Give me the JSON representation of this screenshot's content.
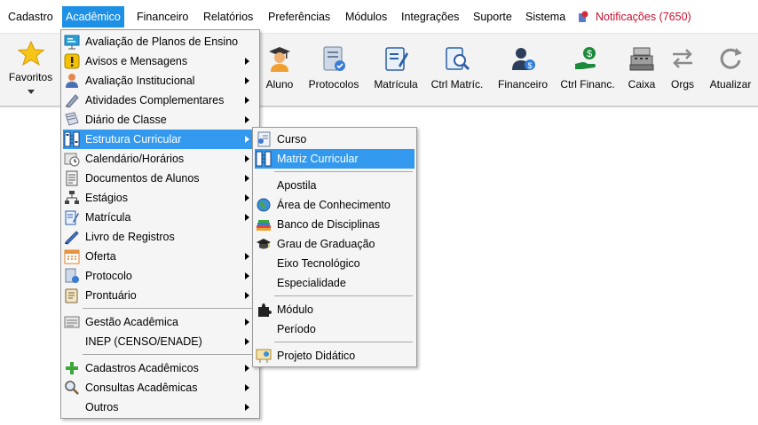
{
  "menubar": {
    "items": [
      "Cadastro",
      "Acadêmico",
      "Financeiro",
      "Relatórios",
      "Preferências",
      "Módulos",
      "Integrações",
      "Suporte",
      "Sistema"
    ],
    "notifications": "Notificações (7650)"
  },
  "toolbar": {
    "favorites": "Favoritos",
    "buttons": [
      "Aluno",
      "Protocolos",
      "Matrícula",
      "Ctrl Matríc.",
      "Financeiro",
      "Ctrl Financ.",
      "Caixa",
      "Orgs",
      "Atualizar"
    ]
  },
  "academic_menu": {
    "items": [
      "Avaliação de Planos de Ensino",
      "Avisos e Mensagens",
      "Avaliação Institucional",
      "Atividades Complementares",
      "Diário de Classe",
      "Estrutura Curricular",
      "Calendário/Horários",
      "Documentos de Alunos",
      "Estágios",
      "Matrícula",
      "Livro de Registros",
      "Oferta",
      "Protocolo",
      "Prontuário",
      "Gestão Acadêmica",
      "INEP (CENSO/ENADE)",
      "Cadastros Acadêmicos",
      "Consultas Acadêmicas",
      "Outros"
    ]
  },
  "curricular_menu": {
    "items": [
      "Curso",
      "Matriz Curricular",
      "Apostila",
      "Área de Conhecimento",
      "Banco de Disciplinas",
      "Grau de Graduação",
      "Eixo Tecnológico",
      "Especialidade",
      "Módulo",
      "Período",
      "Projeto Didático"
    ]
  },
  "colors": {
    "menu_highlight": "#3399ee",
    "menubar_active": "#1e90e6",
    "notification_text": "#c8102e"
  }
}
